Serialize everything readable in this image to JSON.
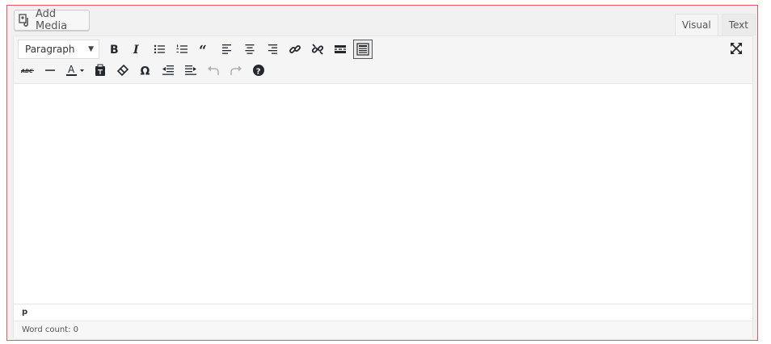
{
  "add_media": {
    "label": "Add Media"
  },
  "tabs": [
    {
      "label": "Visual",
      "active": true
    },
    {
      "label": "Text",
      "active": false
    }
  ],
  "format_select": {
    "value": "Paragraph"
  },
  "toolbar_row1": [
    "bold-icon",
    "italic-icon",
    "bulleted-list-icon",
    "numbered-list-icon",
    "blockquote-icon",
    "align-left-icon",
    "align-center-icon",
    "align-right-icon",
    "insert-link-icon",
    "remove-link-icon",
    "read-more-icon",
    "toolbar-toggle-icon"
  ],
  "toolbar_row2": [
    "strikethrough-icon",
    "horizontal-line-icon",
    "text-color-icon",
    "paste-as-text-icon",
    "clear-formatting-icon",
    "special-character-icon",
    "decrease-indent-icon",
    "increase-indent-icon",
    "undo-icon",
    "redo-icon",
    "help-icon"
  ],
  "path": {
    "text": "p"
  },
  "word_count": {
    "text": "Word count: 0"
  },
  "colors": {
    "frame_border": "#e05a5f",
    "toolbar_bg": "#f5f5f5",
    "icon": "#23282d"
  }
}
